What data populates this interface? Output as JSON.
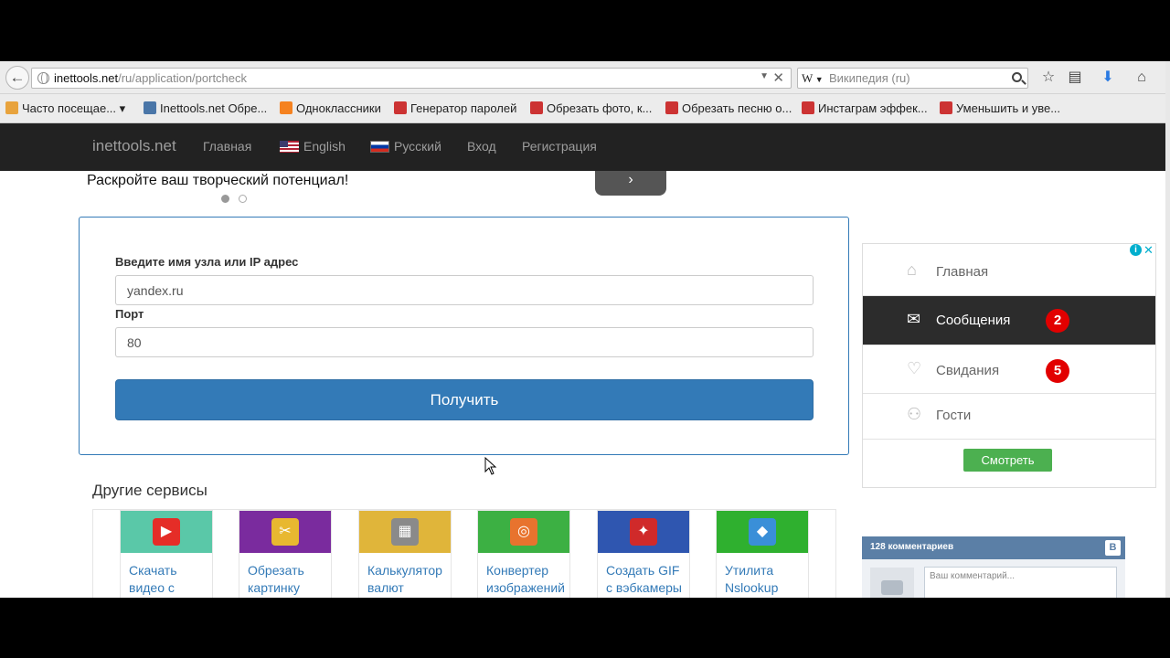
{
  "browser": {
    "url_host": "inettools.net",
    "url_path": "/ru/application/portcheck",
    "search_engine_icon": "W",
    "search_placeholder": "Википедия (ru)"
  },
  "bookmarks": [
    {
      "label": "Часто посещае... ▾",
      "icon": "folder-icon",
      "color": "#e8a33d"
    },
    {
      "label": "Inettools.net Обре...",
      "icon": "vk-icon",
      "color": "#4a76a8"
    },
    {
      "label": "Одноклассники",
      "icon": "odnoklassniki-icon",
      "color": "#f58220"
    },
    {
      "label": "Генератор паролей",
      "icon": "shield-icon",
      "color": "#c33"
    },
    {
      "label": "Обрезать фото, к...",
      "icon": "shield-icon",
      "color": "#c33"
    },
    {
      "label": "Обрезать песню о...",
      "icon": "shield-icon",
      "color": "#c33"
    },
    {
      "label": "Инстаграм эффек...",
      "icon": "shield-icon",
      "color": "#c33"
    },
    {
      "label": "Уменьшить и уве...",
      "icon": "shield-icon",
      "color": "#c33"
    }
  ],
  "site_nav": {
    "brand": "inettools.net",
    "home": "Главная",
    "english": "English",
    "russian": "Русский",
    "login": "Вход",
    "register": "Регистрация"
  },
  "carousel": {
    "slogan": "Раскройте ваш творческий потенциал!",
    "next_glyph": "›"
  },
  "form": {
    "host_label": "Введите имя узла или IP адрес",
    "host_value": "yandex.ru",
    "port_label": "Порт",
    "port_value": "80",
    "submit_label": "Получить"
  },
  "services": {
    "title": "Другие сервисы",
    "items": [
      {
        "line1": "Скачать",
        "line2": "видео с",
        "bg": "#5ac8a8",
        "icon": "youtube-icon",
        "glyph": "▶",
        "glyph_bg": "#e52d27"
      },
      {
        "line1": "Обрезать",
        "line2": "картинку",
        "bg": "#7a2b9e",
        "icon": "crop-image-icon",
        "glyph": "✂",
        "glyph_bg": "#e8b830"
      },
      {
        "line1": "Калькулятор",
        "line2": "валют",
        "bg": "#e0b53a",
        "icon": "calculator-icon",
        "glyph": "▦",
        "glyph_bg": "#8a8a8a"
      },
      {
        "line1": "Конвертер",
        "line2": "изображений",
        "bg": "#3cb043",
        "icon": "converter-icon",
        "glyph": "◎",
        "glyph_bg": "#e8732e"
      },
      {
        "line1": "Создать GIF",
        "line2": "с вэбкамеры",
        "bg": "#2f56b0",
        "icon": "gif-webcam-icon",
        "glyph": "✦",
        "glyph_bg": "#d02a2a"
      },
      {
        "line1": "Утилита",
        "line2": "Nslookup",
        "bg": "#2fb02f",
        "icon": "nslookup-icon",
        "glyph": "◆",
        "glyph_bg": "#3a8fd8"
      }
    ]
  },
  "ad": {
    "info_badge": "i",
    "close_glyph": "✕",
    "items": [
      {
        "label": "Главная",
        "icon": "home-icon",
        "glyph": "⌂",
        "count": ""
      },
      {
        "label": "Сообщения",
        "icon": "envelope-icon",
        "glyph": "✉",
        "count": "2"
      },
      {
        "label": "Свидания",
        "icon": "heart-icon",
        "glyph": "♡",
        "count": "5"
      },
      {
        "label": "Гости",
        "icon": "user-icon",
        "glyph": "⚇",
        "count": ""
      }
    ],
    "button": "Смотреть"
  },
  "comments": {
    "title": "128 комментариев",
    "logo": "В",
    "placeholder": "Ваш комментарий..."
  }
}
